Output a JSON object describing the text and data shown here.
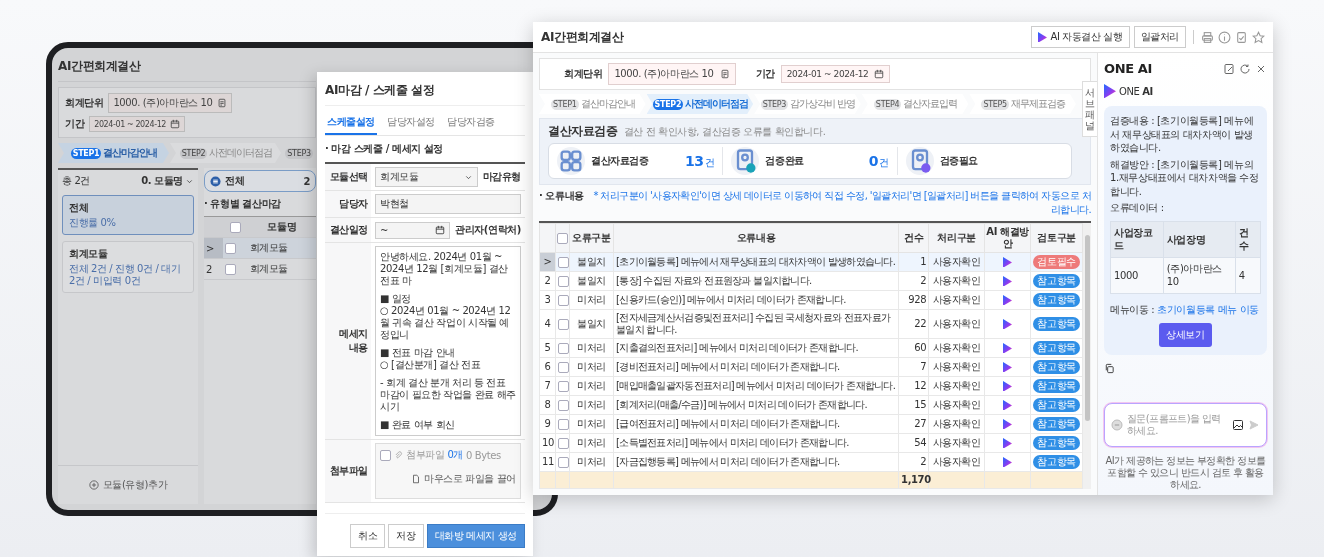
{
  "back_window": {
    "title": "AI간편회계결산",
    "filters": [
      {
        "label": "회계단위",
        "value": "1000. (주)아마란스 10",
        "kind": "code"
      },
      {
        "label": "기간",
        "value": "2024-01 ~ 2024-12",
        "kind": "date"
      }
    ],
    "steps": [
      {
        "step": "STEP1",
        "label": "결산마감안내",
        "selected": true
      },
      {
        "step": "STEP2",
        "label": "사전데이터점검",
        "selected": false
      },
      {
        "step": "STEP3",
        "selected": false
      }
    ],
    "list_header": {
      "total": "총 2건",
      "sort": "0. 모듈명"
    },
    "modules": [
      {
        "name": "전체",
        "detail": "진행률 0%",
        "selected": true
      },
      {
        "name": "회계모듈",
        "detail": "전체 2건 / 진행 0건 / 대기 2건 / 미입력 0건",
        "selected": false
      }
    ],
    "add_button": "모듈(유형)추가",
    "summary": {
      "label": "전체",
      "count": "2"
    },
    "section_title": "· 유형별 결산마감",
    "table": {
      "columns": [
        "모듈명"
      ],
      "all_checked": false,
      "rows": [
        {
          "marker": ">",
          "module": "회계모듈",
          "selected": true,
          "checked": false
        },
        {
          "marker": "2",
          "module": "회계모듈",
          "selected": false,
          "checked": false
        }
      ]
    }
  },
  "dialog": {
    "title": "AI마감 / 스케줄 설정",
    "tabs": [
      {
        "label": "스케줄설정",
        "selected": true
      },
      {
        "label": "담당자설정",
        "selected": false
      },
      {
        "label": "담당자검증",
        "selected": false
      }
    ],
    "section_title": "· 마감 스케줄 / 메세지 설정",
    "fields": [
      {
        "label": "모듈선택",
        "value": "회계모듈",
        "kind": "select",
        "side_label": "마감유형"
      },
      {
        "label": "담당자",
        "value": "박현철",
        "kind": "text"
      },
      {
        "label": "결산일정",
        "value": "~",
        "kind": "date",
        "side_label": "관리자(연락처)"
      }
    ],
    "message": {
      "label": "메세지 내용",
      "paragraphs": [
        [
          "안녕하세요. 2024년 01월 ~ 2024년 12월 [회계모듈] 결산 전표 마"
        ],
        [
          "■ 일정",
          "○ 2024년 01월 ~ 2024년 12월 귀속 결산 작업이 시작될 예정입니"
        ],
        [
          "■ 전표 마감 안내",
          "○ [결산분개] 결산 전표"
        ],
        [
          "- 회계 결산 분개 처리 등 전표 마감이 필요한 작업을 완료 해주시기"
        ],
        [
          "■ 완료 여부 회신"
        ]
      ]
    },
    "attachment": {
      "label": "첨부파일",
      "title": "첨부파일",
      "count": "0개",
      "size": "0 Bytes",
      "drop_hint": "마우스로 파일을 끌어",
      "checked": false
    },
    "buttons": [
      {
        "label": "취소",
        "kind": "default"
      },
      {
        "label": "저장",
        "kind": "default"
      },
      {
        "label": "대화방 메세지 생성",
        "kind": "primary"
      }
    ]
  },
  "main_window": {
    "title": "AI간편회계결산",
    "toolbar_buttons": [
      {
        "label": "AI 자동결산 실행",
        "kind": "ai"
      },
      {
        "label": "일괄처리",
        "kind": "plain"
      }
    ],
    "filters": [
      {
        "label": "회계단위",
        "value": "1000. (주)아마란스 10",
        "kind": "code"
      },
      {
        "label": "기간",
        "value": "2024-01 ~ 2024-12",
        "kind": "date"
      }
    ],
    "side_tab": "서브패널",
    "steps": [
      {
        "step": "STEP1",
        "label": "결산마감안내",
        "selected": false
      },
      {
        "step": "STEP2",
        "label": "사전데이터점검",
        "selected": true
      },
      {
        "step": "STEP3",
        "label": "감가상각비 반영",
        "selected": false
      },
      {
        "step": "STEP4",
        "label": "결산자료입력",
        "selected": false
      },
      {
        "step": "STEP5",
        "label": "재무제표검증",
        "selected": false
      }
    ],
    "summary": {
      "title": "결산자료검증",
      "description": "결산 전 확인사항, 결산검증 오류를 확인합니다.",
      "cards": [
        {
          "label": "결산자료검증",
          "count": "13",
          "unit": "건",
          "kind": "grid"
        },
        {
          "label": "검증완료",
          "count": "0",
          "unit": "건",
          "kind": "done"
        },
        {
          "label": "검증필요",
          "kind": "needed"
        }
      ]
    },
    "errors": {
      "title": "· 오류내용",
      "note": "* 처리구분이 '사용자확인'이면 상세 데이터로 이동하여 직접 수정, '일괄처리'면 [일괄처리] 버튼을 클릭하여 자동으로 처리합니다.",
      "columns": [
        "오류구분",
        "오류내용",
        "건수",
        "처리구분",
        "AI 해결방안",
        "검토구분"
      ],
      "all_checked": false,
      "rows": [
        {
          "marker": ">",
          "type": "불일치",
          "content": "[초기이월등록] 메뉴에서 재무상태표의 대차차액이 발생하였습니다.",
          "count": "1",
          "handling": "사용자확인",
          "review": "검토필수",
          "kind": "required",
          "selected": true,
          "checked": false
        },
        {
          "marker": "2",
          "type": "불일치",
          "content": "[통장] 수집된 자료와 전표원장과 불일치합니다.",
          "count": "2",
          "handling": "사용자확인",
          "review": "참고항목",
          "kind": "reference",
          "selected": false,
          "checked": false
        },
        {
          "marker": "3",
          "type": "미처리",
          "content": "[신용카드(승인)] 메뉴에서 미처리 데이터가 존재합니다.",
          "count": "928",
          "handling": "사용자확인",
          "review": "참고항목",
          "kind": "reference",
          "selected": false,
          "checked": false
        },
        {
          "marker": "4",
          "type": "불일치",
          "content": "[전자세금계산서검증및전표처리] 수집된 국세청자료와 전표자료가 불일치 합니다.",
          "count": "22",
          "handling": "사용자확인",
          "review": "참고항목",
          "kind": "reference",
          "selected": false,
          "checked": false
        },
        {
          "marker": "5",
          "type": "미처리",
          "content": "[지출결의전표처리] 메뉴에서 미처리 데이터가 존재합니다.",
          "count": "60",
          "handling": "사용자확인",
          "review": "참고항목",
          "kind": "reference",
          "selected": false,
          "checked": false
        },
        {
          "marker": "6",
          "type": "미처리",
          "content": "[경비전표처리] 메뉴에서 미처리 데이터가 존재합니다.",
          "count": "7",
          "handling": "사용자확인",
          "review": "참고항목",
          "kind": "reference",
          "selected": false,
          "checked": false
        },
        {
          "marker": "7",
          "type": "미처리",
          "content": "[매입매출일괄자동전표처리] 메뉴에서 미처리 데이터가 존재합니다.",
          "count": "12",
          "handling": "사용자확인",
          "review": "참고항목",
          "kind": "reference",
          "selected": false,
          "checked": false
        },
        {
          "marker": "8",
          "type": "미처리",
          "content": "[회계처리(매출/수금)] 메뉴에서 미처리 데이터가 존재합니다.",
          "count": "15",
          "handling": "사용자확인",
          "review": "참고항목",
          "kind": "reference",
          "selected": false,
          "checked": false
        },
        {
          "marker": "9",
          "type": "미처리",
          "content": "[급여전표처리] 메뉴에서 미처리 데이터가 존재합니다.",
          "count": "27",
          "handling": "사용자확인",
          "review": "참고항목",
          "kind": "reference",
          "selected": false,
          "checked": false
        },
        {
          "marker": "10",
          "type": "미처리",
          "content": "[소득별전표처리] 메뉴에서 미처리 데이터가 존재합니다.",
          "count": "54",
          "handling": "사용자확인",
          "review": "참고항목",
          "kind": "reference",
          "selected": false,
          "checked": false
        },
        {
          "marker": "11",
          "type": "미처리",
          "content": "[자금집행등록] 메뉴에서 미처리 데이터가 존재합니다.",
          "count": "2",
          "handling": "사용자확인",
          "review": "참고항목",
          "kind": "reference",
          "selected": false,
          "checked": false
        }
      ],
      "total": "1,170"
    }
  },
  "ai_panel": {
    "title": "ONE AI",
    "brand": "ONE **AI**",
    "message": {
      "lines": [
        "검증내용 : [초기이월등록] 메뉴에서 재무상태표의 대차차액이 발생하였습니다.",
        "해결방안 : [초기이월등록] 메뉴의 1.재무상태표에서 대차차액을 수정합니다.",
        "오류데이터 :"
      ],
      "table": {
        "columns": [
          "사업장코드",
          "사업장명",
          "건수"
        ],
        "rows": [
          [
            "1000",
            "(주)아마란스 10",
            "4"
          ]
        ]
      },
      "menu_label": "메뉴이동 :",
      "menu_link": "초기이월등록 메뉴 이동",
      "button": "상세보기"
    },
    "input": {
      "placeholder": "질문(프롬프트)을 입력하세요."
    },
    "disclaimer": "AI가 제공하는 정보는 부정확한 정보를 포함할 수 있으니 반드시 검토 후 활용하세요."
  }
}
